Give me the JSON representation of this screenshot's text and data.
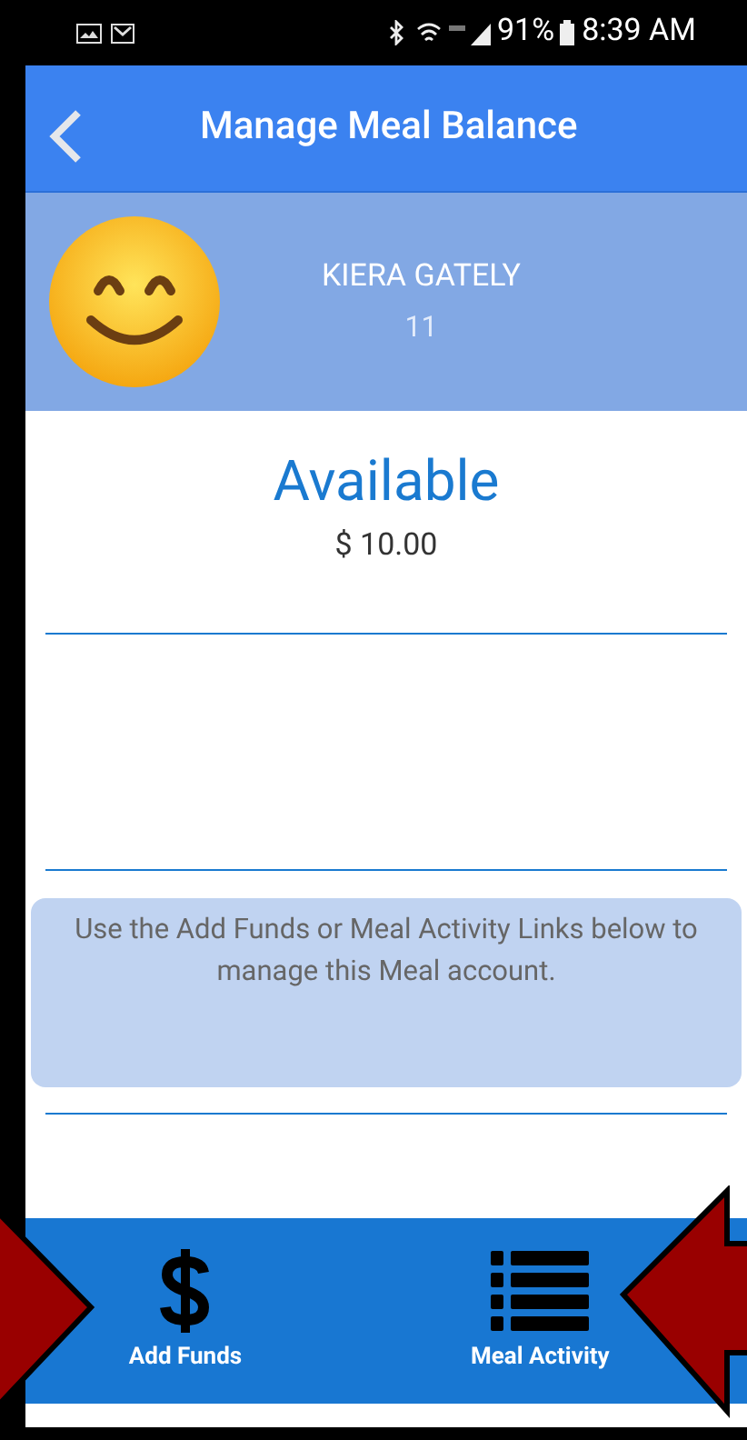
{
  "status_bar": {
    "battery": "91%",
    "time": "8:39 AM"
  },
  "header": {
    "title": "Manage Meal Balance"
  },
  "profile": {
    "name": "KIERA GATELY",
    "grade": "11"
  },
  "balance": {
    "label": "Available",
    "amount": "$ 10.00"
  },
  "note": "Use the Add Funds or Meal Activity Links below to manage this Meal account.",
  "bottom_bar": [
    {
      "kind": "funds",
      "label": "Add Funds"
    },
    {
      "kind": "activity",
      "label": "Meal Activity"
    }
  ]
}
